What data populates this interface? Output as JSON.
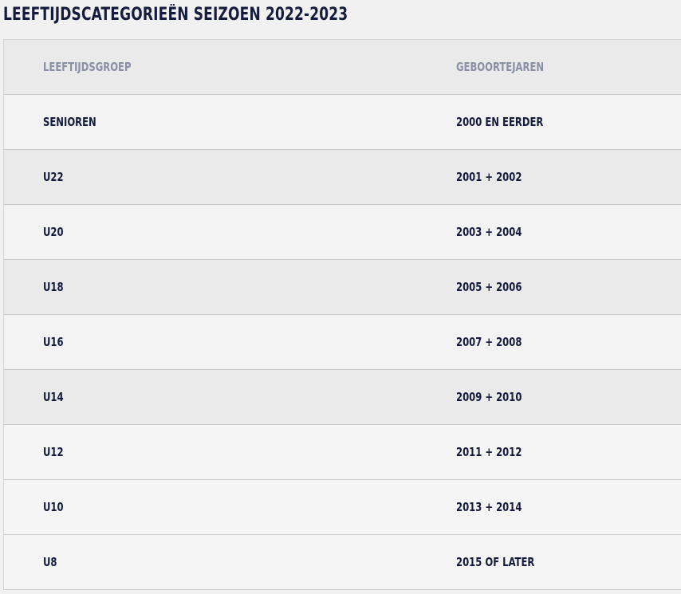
{
  "title": "LEEFTIJDSCATEGORIEËN SEIZOEN 2022-2023",
  "table": {
    "headers": [
      "LEEFTIJDSGROEP",
      "GEBOORTEJAREN"
    ],
    "rows": [
      {
        "group": "SENIOREN",
        "years": "2000 EN EERDER"
      },
      {
        "group": "U22",
        "years": "2001 + 2002"
      },
      {
        "group": "U20",
        "years": "2003 + 2004"
      },
      {
        "group": "U18",
        "years": "2005 + 2006"
      },
      {
        "group": "U16",
        "years": "2007 + 2008"
      },
      {
        "group": "U14",
        "years": "2009 + 2010"
      },
      {
        "group": "U12",
        "years": "2011 + 2012"
      },
      {
        "group": "U10",
        "years": "2013 + 2014"
      },
      {
        "group": "U8",
        "years": "2015 OF LATER"
      }
    ]
  }
}
